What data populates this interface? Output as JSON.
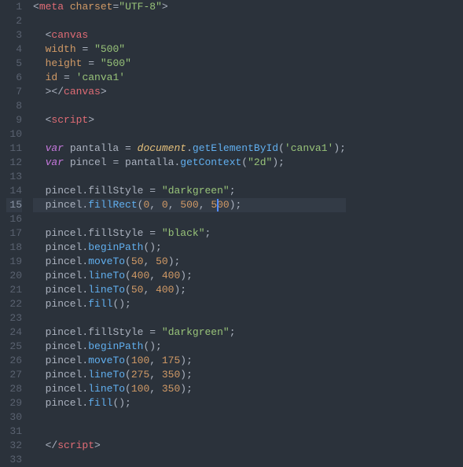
{
  "editor": {
    "line_count": 33,
    "highlighted_line": 15,
    "cursor_line": 15,
    "cursor_after_text": "  pincel.fillRect(0, 0, 500, 5",
    "lines": [
      {
        "n": 1,
        "t": [
          [
            "punc",
            "<"
          ],
          [
            "tag",
            "meta"
          ],
          [
            "plain",
            " "
          ],
          [
            "attr",
            "charset"
          ],
          [
            "punc",
            "="
          ],
          [
            "str",
            "\"UTF-8\""
          ],
          [
            "punc",
            ">"
          ]
        ]
      },
      {
        "n": 2,
        "t": []
      },
      {
        "n": 3,
        "t": [
          [
            "plain",
            "  "
          ],
          [
            "punc",
            "<"
          ],
          [
            "tag",
            "canvas"
          ]
        ]
      },
      {
        "n": 4,
        "t": [
          [
            "plain",
            "  "
          ],
          [
            "attr",
            "width"
          ],
          [
            "plain",
            " "
          ],
          [
            "punc",
            "="
          ],
          [
            "plain",
            " "
          ],
          [
            "str",
            "\"500\""
          ]
        ]
      },
      {
        "n": 5,
        "t": [
          [
            "plain",
            "  "
          ],
          [
            "attr",
            "height"
          ],
          [
            "plain",
            " "
          ],
          [
            "punc",
            "="
          ],
          [
            "plain",
            " "
          ],
          [
            "str",
            "\"500\""
          ]
        ]
      },
      {
        "n": 6,
        "t": [
          [
            "plain",
            "  "
          ],
          [
            "attr",
            "id"
          ],
          [
            "plain",
            " "
          ],
          [
            "punc",
            "="
          ],
          [
            "plain",
            " "
          ],
          [
            "str",
            "'canva1'"
          ]
        ]
      },
      {
        "n": 7,
        "t": [
          [
            "plain",
            "  "
          ],
          [
            "punc",
            "></"
          ],
          [
            "tag",
            "canvas"
          ],
          [
            "punc",
            ">"
          ]
        ]
      },
      {
        "n": 8,
        "t": []
      },
      {
        "n": 9,
        "t": [
          [
            "plain",
            "  "
          ],
          [
            "punc",
            "<"
          ],
          [
            "tag",
            "script"
          ],
          [
            "punc",
            ">"
          ]
        ]
      },
      {
        "n": 10,
        "t": []
      },
      {
        "n": 11,
        "t": [
          [
            "plain",
            "  "
          ],
          [
            "kw",
            "var"
          ],
          [
            "plain",
            " pantalla "
          ],
          [
            "punc",
            "="
          ],
          [
            "plain",
            " "
          ],
          [
            "builtin",
            "document"
          ],
          [
            "punc",
            "."
          ],
          [
            "fn",
            "getElementById"
          ],
          [
            "punc",
            "("
          ],
          [
            "str",
            "'canva1'"
          ],
          [
            "punc",
            ");"
          ]
        ]
      },
      {
        "n": 12,
        "t": [
          [
            "plain",
            "  "
          ],
          [
            "kw",
            "var"
          ],
          [
            "plain",
            " pincel "
          ],
          [
            "punc",
            "="
          ],
          [
            "plain",
            " pantalla"
          ],
          [
            "punc",
            "."
          ],
          [
            "fn",
            "getContext"
          ],
          [
            "punc",
            "("
          ],
          [
            "str",
            "\"2d\""
          ],
          [
            "punc",
            ");"
          ]
        ]
      },
      {
        "n": 13,
        "t": []
      },
      {
        "n": 14,
        "t": [
          [
            "plain",
            "  pincel"
          ],
          [
            "punc",
            "."
          ],
          [
            "prop",
            "fillStyle"
          ],
          [
            "plain",
            " "
          ],
          [
            "punc",
            "="
          ],
          [
            "plain",
            " "
          ],
          [
            "str",
            "\"darkgreen\""
          ],
          [
            "punc",
            ";"
          ]
        ]
      },
      {
        "n": 15,
        "t": [
          [
            "plain",
            "  pincel"
          ],
          [
            "punc",
            "."
          ],
          [
            "fn",
            "fillRect"
          ],
          [
            "punc",
            "("
          ],
          [
            "num",
            "0"
          ],
          [
            "punc",
            ", "
          ],
          [
            "num",
            "0"
          ],
          [
            "punc",
            ", "
          ],
          [
            "num",
            "500"
          ],
          [
            "punc",
            ", "
          ],
          [
            "num",
            "500"
          ],
          [
            "punc",
            ");"
          ]
        ]
      },
      {
        "n": 16,
        "t": []
      },
      {
        "n": 17,
        "t": [
          [
            "plain",
            "  pincel"
          ],
          [
            "punc",
            "."
          ],
          [
            "prop",
            "fillStyle"
          ],
          [
            "plain",
            " "
          ],
          [
            "punc",
            "="
          ],
          [
            "plain",
            " "
          ],
          [
            "str",
            "\"black\""
          ],
          [
            "punc",
            ";"
          ]
        ]
      },
      {
        "n": 18,
        "t": [
          [
            "plain",
            "  pincel"
          ],
          [
            "punc",
            "."
          ],
          [
            "fn",
            "beginPath"
          ],
          [
            "punc",
            "();"
          ]
        ]
      },
      {
        "n": 19,
        "t": [
          [
            "plain",
            "  pincel"
          ],
          [
            "punc",
            "."
          ],
          [
            "fn",
            "moveTo"
          ],
          [
            "punc",
            "("
          ],
          [
            "num",
            "50"
          ],
          [
            "punc",
            ", "
          ],
          [
            "num",
            "50"
          ],
          [
            "punc",
            ");"
          ]
        ]
      },
      {
        "n": 20,
        "t": [
          [
            "plain",
            "  pincel"
          ],
          [
            "punc",
            "."
          ],
          [
            "fn",
            "lineTo"
          ],
          [
            "punc",
            "("
          ],
          [
            "num",
            "400"
          ],
          [
            "punc",
            ", "
          ],
          [
            "num",
            "400"
          ],
          [
            "punc",
            ");"
          ]
        ]
      },
      {
        "n": 21,
        "t": [
          [
            "plain",
            "  pincel"
          ],
          [
            "punc",
            "."
          ],
          [
            "fn",
            "lineTo"
          ],
          [
            "punc",
            "("
          ],
          [
            "num",
            "50"
          ],
          [
            "punc",
            ", "
          ],
          [
            "num",
            "400"
          ],
          [
            "punc",
            ");"
          ]
        ]
      },
      {
        "n": 22,
        "t": [
          [
            "plain",
            "  pincel"
          ],
          [
            "punc",
            "."
          ],
          [
            "fn",
            "fill"
          ],
          [
            "punc",
            "();"
          ]
        ]
      },
      {
        "n": 23,
        "t": []
      },
      {
        "n": 24,
        "t": [
          [
            "plain",
            "  pincel"
          ],
          [
            "punc",
            "."
          ],
          [
            "prop",
            "fillStyle"
          ],
          [
            "plain",
            " "
          ],
          [
            "punc",
            "="
          ],
          [
            "plain",
            " "
          ],
          [
            "str",
            "\"darkgreen\""
          ],
          [
            "punc",
            ";"
          ]
        ]
      },
      {
        "n": 25,
        "t": [
          [
            "plain",
            "  pincel"
          ],
          [
            "punc",
            "."
          ],
          [
            "fn",
            "beginPath"
          ],
          [
            "punc",
            "();"
          ]
        ]
      },
      {
        "n": 26,
        "t": [
          [
            "plain",
            "  pincel"
          ],
          [
            "punc",
            "."
          ],
          [
            "fn",
            "moveTo"
          ],
          [
            "punc",
            "("
          ],
          [
            "num",
            "100"
          ],
          [
            "punc",
            ", "
          ],
          [
            "num",
            "175"
          ],
          [
            "punc",
            ");"
          ]
        ]
      },
      {
        "n": 27,
        "t": [
          [
            "plain",
            "  pincel"
          ],
          [
            "punc",
            "."
          ],
          [
            "fn",
            "lineTo"
          ],
          [
            "punc",
            "("
          ],
          [
            "num",
            "275"
          ],
          [
            "punc",
            ", "
          ],
          [
            "num",
            "350"
          ],
          [
            "punc",
            ");"
          ]
        ]
      },
      {
        "n": 28,
        "t": [
          [
            "plain",
            "  pincel"
          ],
          [
            "punc",
            "."
          ],
          [
            "fn",
            "lineTo"
          ],
          [
            "punc",
            "("
          ],
          [
            "num",
            "100"
          ],
          [
            "punc",
            ", "
          ],
          [
            "num",
            "350"
          ],
          [
            "punc",
            ");"
          ]
        ]
      },
      {
        "n": 29,
        "t": [
          [
            "plain",
            "  pincel"
          ],
          [
            "punc",
            "."
          ],
          [
            "fn",
            "fill"
          ],
          [
            "punc",
            "();"
          ]
        ]
      },
      {
        "n": 30,
        "t": []
      },
      {
        "n": 31,
        "t": []
      },
      {
        "n": 32,
        "t": [
          [
            "plain",
            "  "
          ],
          [
            "punc",
            "</"
          ],
          [
            "tag",
            "script"
          ],
          [
            "punc",
            ">"
          ]
        ]
      },
      {
        "n": 33,
        "t": []
      }
    ]
  }
}
